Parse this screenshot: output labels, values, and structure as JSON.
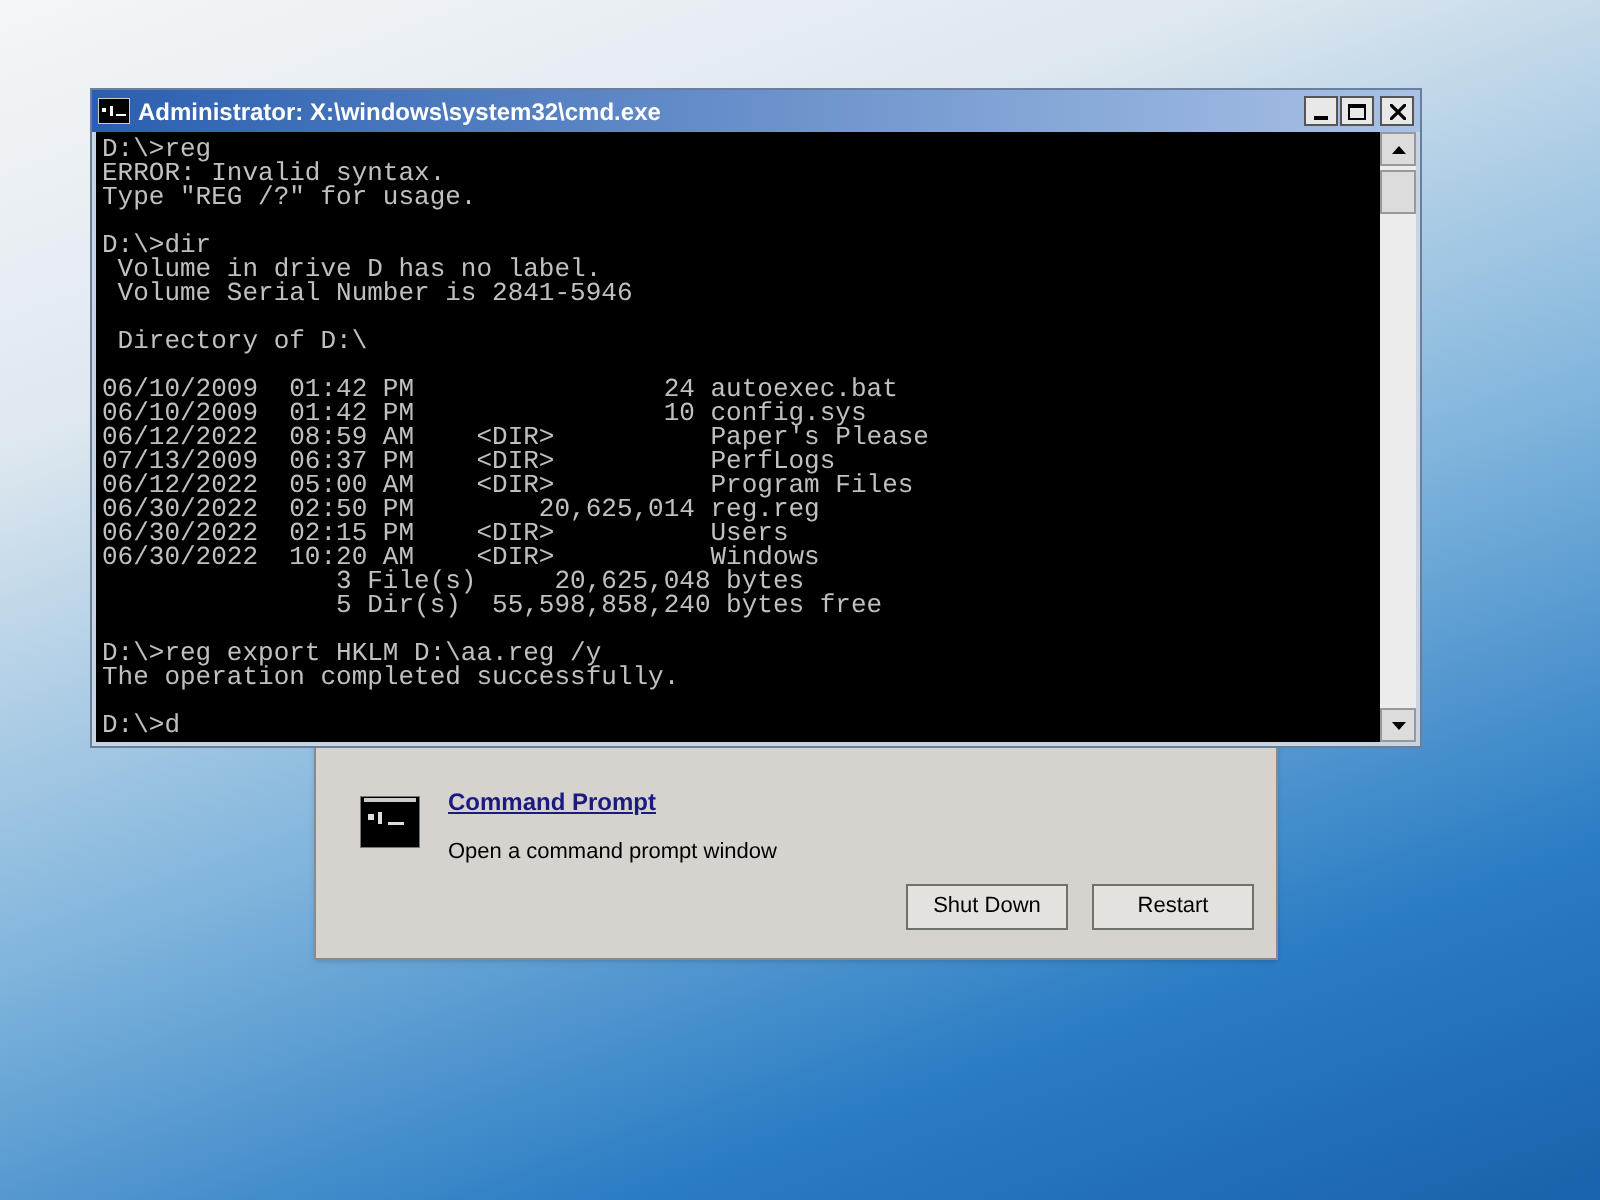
{
  "console_window": {
    "title": "Administrator: X:\\windows\\system32\\cmd.exe",
    "blocks": [
      [
        "D:\\>reg",
        "ERROR: Invalid syntax.",
        "Type \"REG /?\" for usage."
      ],
      [
        "D:\\>dir",
        " Volume in drive D has no label.",
        " Volume Serial Number is 2841-5946"
      ],
      [
        " Directory of D:\\"
      ],
      [
        "06/10/2009  01:42 PM                24 autoexec.bat",
        "06/10/2009  01:42 PM                10 config.sys",
        "06/12/2022  08:59 AM    <DIR>          Paper's Please",
        "07/13/2009  06:37 PM    <DIR>          PerfLogs",
        "06/12/2022  05:00 AM    <DIR>          Program Files",
        "06/30/2022  02:50 PM        20,625,014 reg.reg",
        "06/30/2022  02:15 PM    <DIR>          Users",
        "06/30/2022  10:20 AM    <DIR>          Windows",
        "               3 File(s)     20,625,048 bytes",
        "               5 Dir(s)  55,598,858,240 bytes free"
      ],
      [
        "D:\\>reg export HKLM D:\\aa.reg /y",
        "The operation completed successfully."
      ],
      [
        "D:\\>d"
      ]
    ]
  },
  "recovery_dialog": {
    "option": {
      "title": "Command Prompt",
      "description": "Open a command prompt window"
    },
    "buttons": [
      "Shut Down",
      "Restart"
    ]
  }
}
